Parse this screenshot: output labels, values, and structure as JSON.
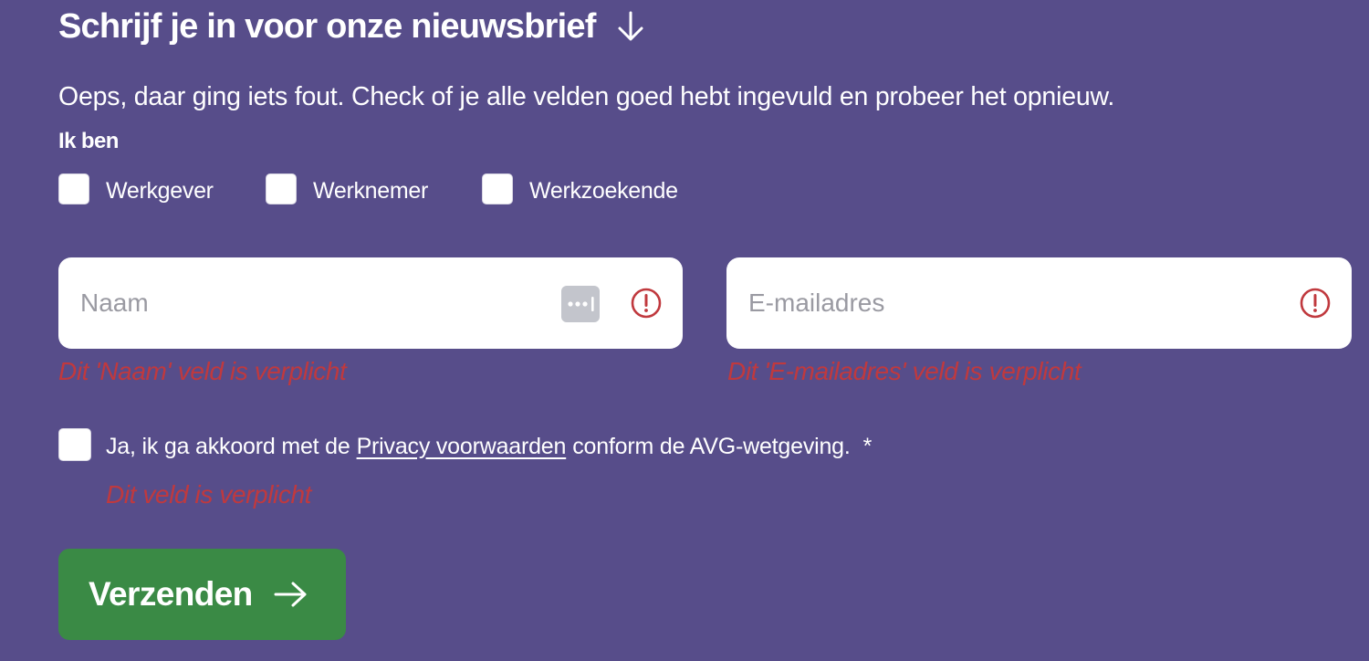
{
  "newsletter": {
    "heading": "Schrijf je in voor onze nieuwsbrief",
    "heading_icon": "arrow-down-icon",
    "error_message": "Oeps, daar ging iets fout. Check of je alle velden goed hebt ingevuld en probeer het opnieuw.",
    "role_group_label": "Ik ben",
    "roles": [
      {
        "label": "Werkgever",
        "checked": false
      },
      {
        "label": "Werknemer",
        "checked": false
      },
      {
        "label": "Werkzoekende",
        "checked": false
      }
    ],
    "name_field": {
      "placeholder": "Naam",
      "value": "",
      "error": "Dit 'Naam' veld is verplicht",
      "icons": [
        "password-manager-icon",
        "alert-icon"
      ]
    },
    "email_field": {
      "placeholder": "E-mailadres",
      "value": "",
      "error": "Dit 'E-mailadres' veld is verplicht",
      "icons": [
        "alert-icon"
      ]
    },
    "consent": {
      "checked": false,
      "text_before": "Ja, ik ga akkoord met de",
      "link_text": "Privacy voorwaarden",
      "text_after": "conform de AVG-wetgeving.",
      "required_marker": "*",
      "error": "Dit veld is verplicht"
    },
    "submit": {
      "label": "Verzenden",
      "icon": "arrow-right-icon"
    }
  },
  "colors": {
    "background": "#574d8a",
    "text": "#ffffff",
    "error": "#c0393e",
    "submit": "#3a8a45",
    "placeholder": "#9a9aa2"
  }
}
